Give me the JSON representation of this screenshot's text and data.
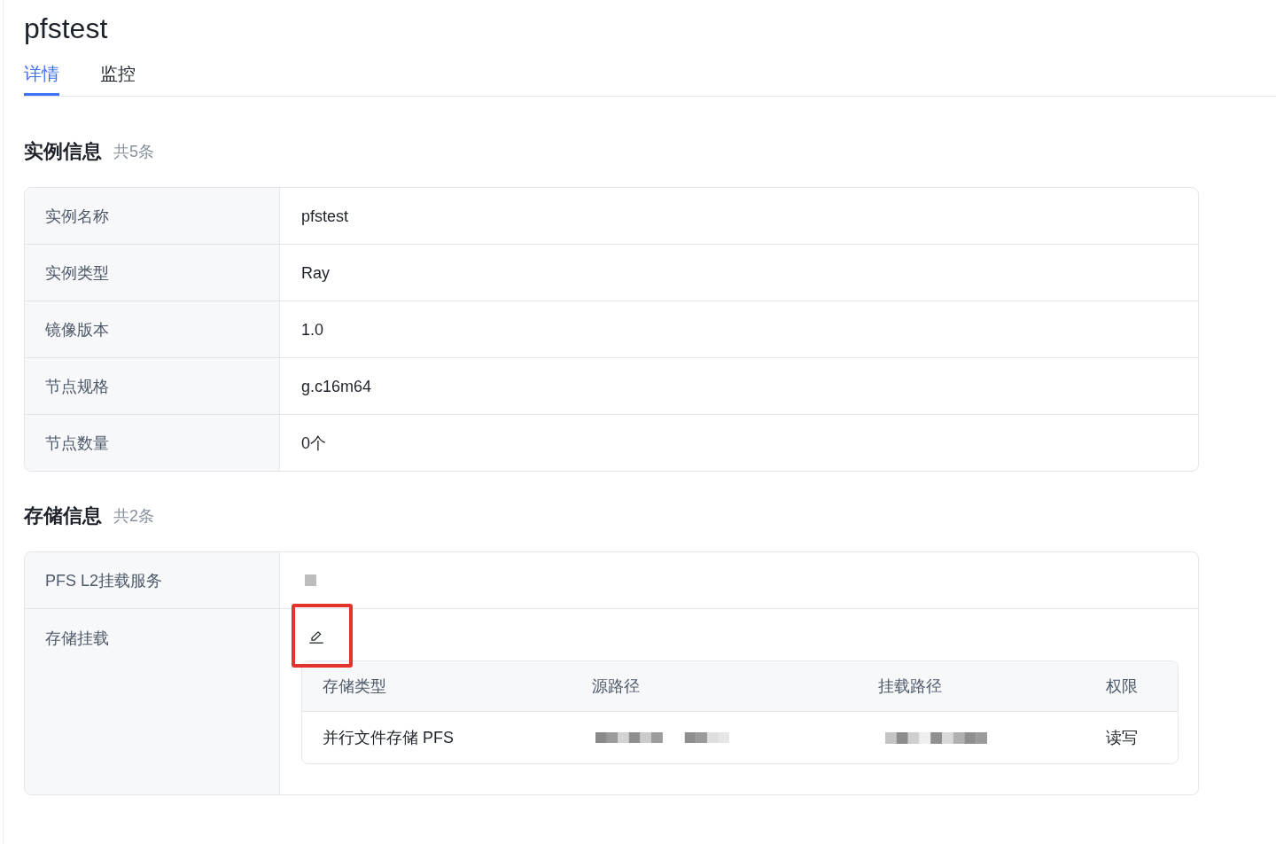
{
  "page": {
    "title": "pfstest"
  },
  "tabs": [
    {
      "label": "详情",
      "selected": true
    },
    {
      "label": "监控",
      "selected": false
    }
  ],
  "instance_info": {
    "title": "实例信息",
    "count": "共5条",
    "rows": [
      {
        "label": "实例名称",
        "value": "pfstest"
      },
      {
        "label": "实例类型",
        "value": "Ray"
      },
      {
        "label": "镜像版本",
        "value": "1.0"
      },
      {
        "label": "节点规格",
        "value": "g.c16m64"
      },
      {
        "label": "节点数量",
        "value": "0个"
      }
    ]
  },
  "storage_info": {
    "title": "存储信息",
    "count": "共2条",
    "rows": [
      {
        "label": "PFS L2挂载服务",
        "kind": "redacted"
      },
      {
        "label": "存储挂载",
        "kind": "mounts",
        "edit_highlighted": true,
        "table": {
          "columns": [
            "存储类型",
            "源路径",
            "挂载路径",
            "权限"
          ],
          "rows": [
            [
              {
                "kind": "text",
                "text": "并行文件存储 PFS"
              },
              {
                "kind": "redacted"
              },
              {
                "kind": "redacted"
              },
              {
                "kind": "text",
                "text": "读写"
              }
            ]
          ]
        }
      }
    ]
  }
}
